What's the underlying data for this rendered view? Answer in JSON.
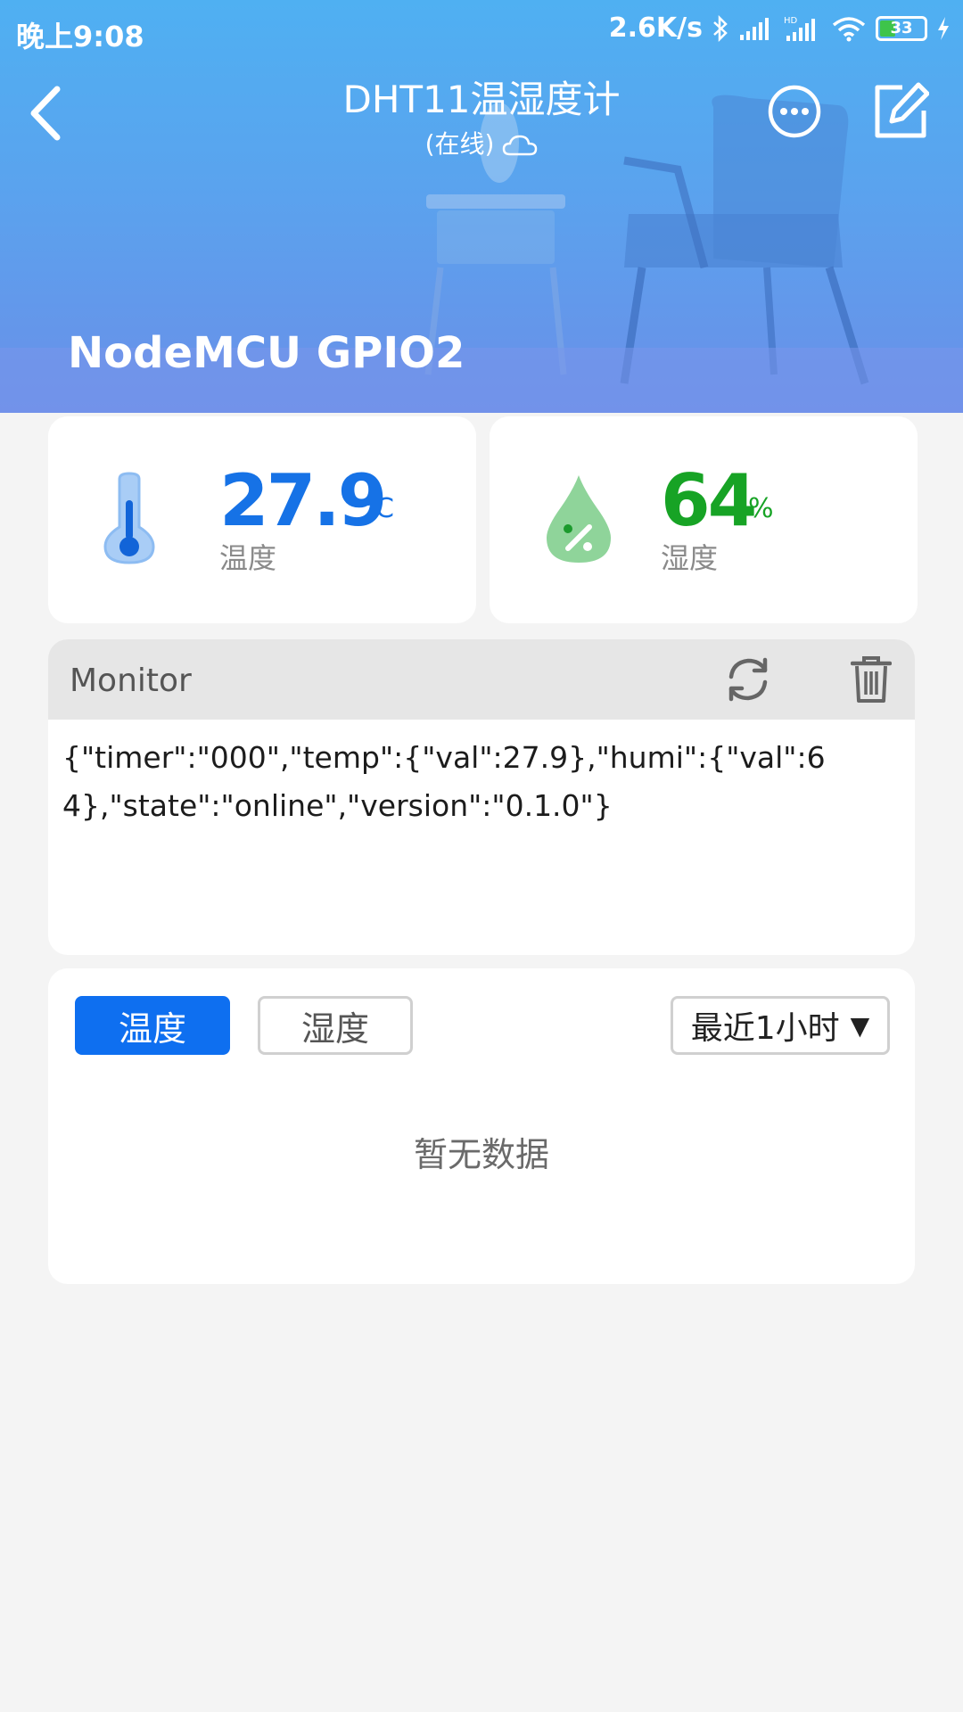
{
  "status_bar": {
    "time": "晚上9:08",
    "network_speed": "2.6K/s",
    "battery_level": "33",
    "icons": [
      "bluetooth-icon",
      "signal-icon",
      "hd-signal-icon",
      "wifi-icon",
      "battery-icon",
      "charging-icon"
    ]
  },
  "header": {
    "title": "DHT11温湿度计",
    "subtitle": "(在线)",
    "device_name": "NodeMCU GPIO2",
    "colors": {
      "gradient_top": "#4fb0f2",
      "gradient_bottom": "#6a8fe8"
    }
  },
  "temperature": {
    "value": "27.9",
    "unit": "°C",
    "label": "温度",
    "color": "#1672e6",
    "icon": "thermometer-icon"
  },
  "humidity": {
    "value": "64",
    "unit": "%",
    "label": "湿度",
    "color": "#17a325",
    "icon": "humidity-drop-icon"
  },
  "monitor": {
    "title": "Monitor",
    "content": "{\"timer\":\"000\",\"temp\":{\"val\":27.9},\"humi\":{\"val\":64},\"state\":\"online\",\"version\":\"0.1.0\"}"
  },
  "history": {
    "tabs": [
      {
        "label": "温度",
        "active": true
      },
      {
        "label": "湿度",
        "active": false
      }
    ],
    "range": {
      "selected": "最近1小时",
      "caret": "▼"
    },
    "empty_text": "暂无数据",
    "accent_color": "#0e6ff0"
  }
}
